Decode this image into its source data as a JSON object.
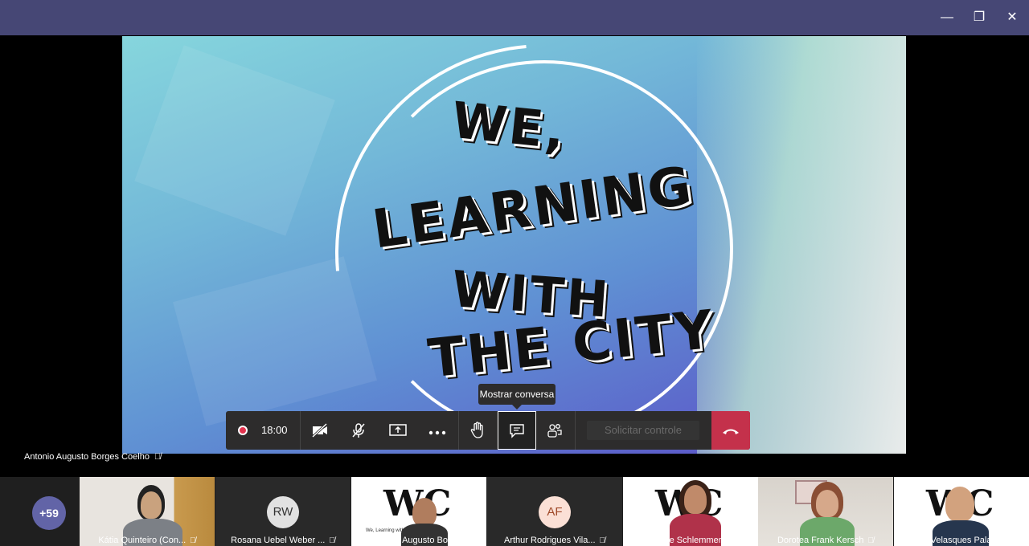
{
  "window": {
    "minimize_icon": "—",
    "restore_icon": "❐",
    "close_icon": "✕"
  },
  "slide": {
    "line1": "WE,",
    "line2": "LEARNING",
    "line3": "WITH",
    "line4": "THE CITY"
  },
  "tooltip": "Mostrar conversa",
  "toolbar": {
    "timer": "18:00",
    "request_control": "Solicitar controle"
  },
  "speaker": {
    "name": "Antonio Augusto Borges Coelho"
  },
  "participants": {
    "more_count": "+59",
    "tiles": [
      {
        "name": "Kátia Quinteiro (Con...",
        "kind": "video"
      },
      {
        "name": "Rosana Uebel Weber ...",
        "kind": "initials",
        "initials": "RW",
        "bg": "#e1e1e1",
        "fg": "#333"
      },
      {
        "name": "Antonio Augusto Bor...",
        "kind": "wc"
      },
      {
        "name": "Arthur Rodrigues Vila...",
        "kind": "initials",
        "initials": "AF",
        "bg": "#fbe0d6",
        "fg": "#a04a2a"
      },
      {
        "name": "Eliane Schlemmer",
        "kind": "wc"
      },
      {
        "name": "Dorotea Frank Kersch",
        "kind": "video"
      },
      {
        "name": "Joao Velasques Palad...",
        "kind": "wc"
      }
    ],
    "wc_text": "WC",
    "wc_sub": "We, Learning with the City Cibricity"
  },
  "colors": {
    "title_bar": "#464775",
    "hangup": "#c4314b",
    "accent": "#6264a7"
  }
}
